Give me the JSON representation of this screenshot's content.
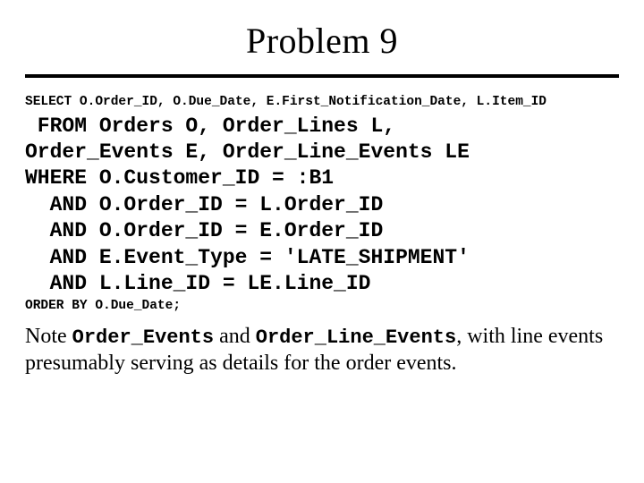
{
  "title": "Problem 9",
  "sql": {
    "select_line": "SELECT O.Order_ID, O.Due_Date, E.First_Notification_Date, L.Item_ID",
    "from_lines": " FROM Orders O, Order_Lines L,\nOrder_Events E, Order_Line_Events LE\nWHERE O.Customer_ID = :B1\n  AND O.Order_ID = L.Order_ID\n  AND O.Order_ID = E.Order_ID\n  AND E.Event_Type = 'LATE_SHIPMENT'\n  AND L.Line_ID = LE.Line_ID",
    "order_by_line": "ORDER BY O.Due_Date;"
  },
  "note": {
    "prefix": "Note ",
    "code1": "Order_Events",
    "mid": " and ",
    "code2": "Order_Line_Events",
    "suffix": ", with line events presumably serving as details for the order events."
  }
}
